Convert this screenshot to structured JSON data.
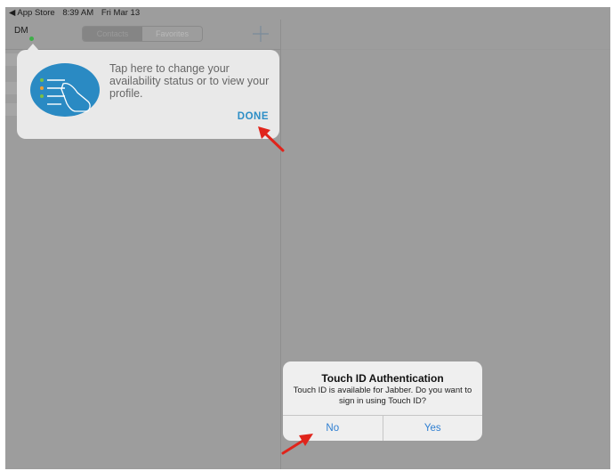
{
  "status_bar": {
    "back_app": "◀ App Store",
    "time": "8:39 AM",
    "date": "Fri Mar 13"
  },
  "navbar": {
    "avatar_initials": "DM",
    "tabs": [
      {
        "label": "Contacts",
        "selected": true
      },
      {
        "label": "Favorites",
        "selected": false
      }
    ],
    "add_icon": "plus-icon"
  },
  "popover": {
    "message": "Tap here to change your availability status or to view your profile.",
    "done_label": "DONE",
    "illustration_icon": "tap-hint-icon"
  },
  "alert": {
    "title": "Touch ID Authentication",
    "message": "Touch ID is available for Jabber. Do you want to sign in using Touch ID?",
    "buttons": [
      "No",
      "Yes"
    ]
  },
  "colors": {
    "accent": "#2d8ec6",
    "annotation_arrow": "#e0241b",
    "presence": "#3fae49"
  }
}
